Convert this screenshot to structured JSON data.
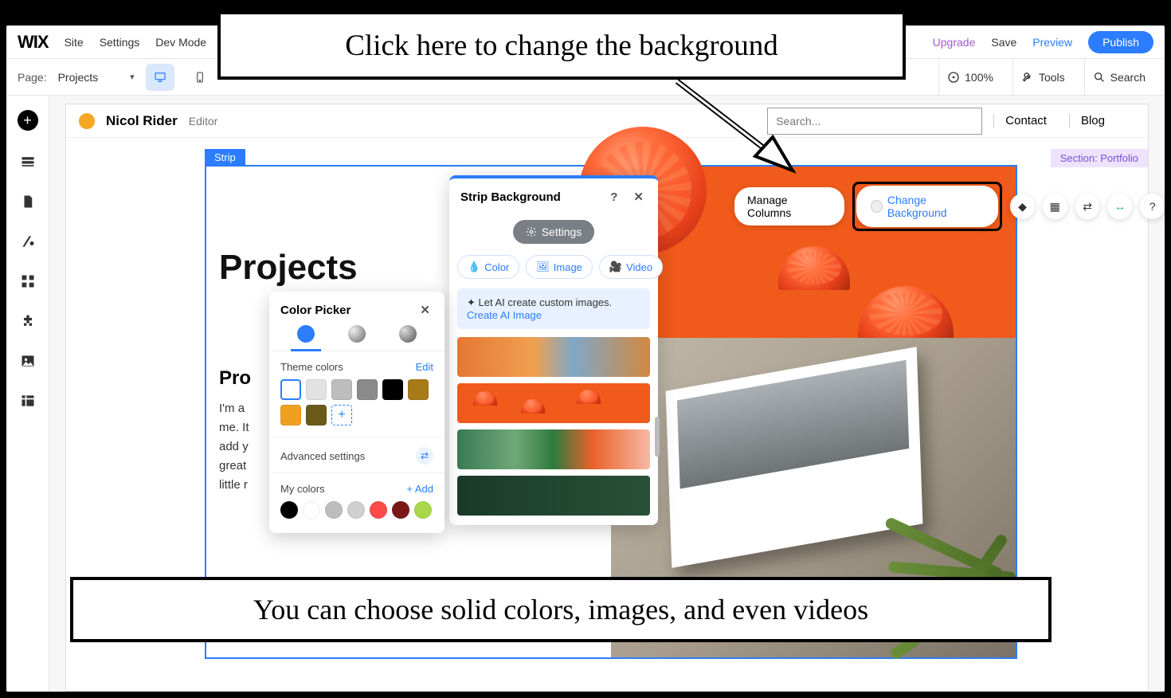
{
  "topbar": {
    "logo": "WIX",
    "menu": [
      "Site",
      "Settings",
      "Dev Mode"
    ],
    "upgrade": "Upgrade",
    "save": "Save",
    "preview": "Preview",
    "publish": "Publish"
  },
  "subbar": {
    "page_label": "Page:",
    "page_name": "Projects",
    "zoom": "100%",
    "tools": "Tools",
    "search": "Search"
  },
  "site_header": {
    "name": "Nicol Rider",
    "editor": "Editor",
    "search_placeholder": "Search...",
    "links": [
      "Contact",
      "Blog"
    ]
  },
  "strip": {
    "label": "Strip",
    "section_label": "Section: Portfolio"
  },
  "content": {
    "h1": "Projects",
    "h2": "Pro",
    "para": "I'm a\nme. It\nadd y\ngreat\nlittle r"
  },
  "floating": {
    "manage": "Manage Columns",
    "change_bg": "Change Background"
  },
  "bg_panel": {
    "title": "Strip Background",
    "settings": "Settings",
    "types": {
      "color": "Color",
      "image": "Image",
      "video": "Video"
    },
    "ai_text": "Let AI create custom images.",
    "ai_link": "Create AI Image"
  },
  "color_picker": {
    "title": "Color Picker",
    "theme_label": "Theme colors",
    "edit": "Edit",
    "advanced": "Advanced settings",
    "my_colors": "My colors",
    "add": "+ Add",
    "theme_swatches": [
      "#ffffff",
      "#e2e2e2",
      "#bdbdbd",
      "#8a8a8a",
      "#000000",
      "#a87a1a",
      "#f0a020",
      "#6a5a1a"
    ],
    "my_swatches": [
      "#000000",
      "#ffffff",
      "#bdbdbd",
      "#cfcfcf",
      "#ff4a4a",
      "#7a1818",
      "#a8d84a"
    ]
  },
  "callouts": {
    "top": "Click here to change the background",
    "bottom": "You can choose solid colors, images, and even videos"
  }
}
